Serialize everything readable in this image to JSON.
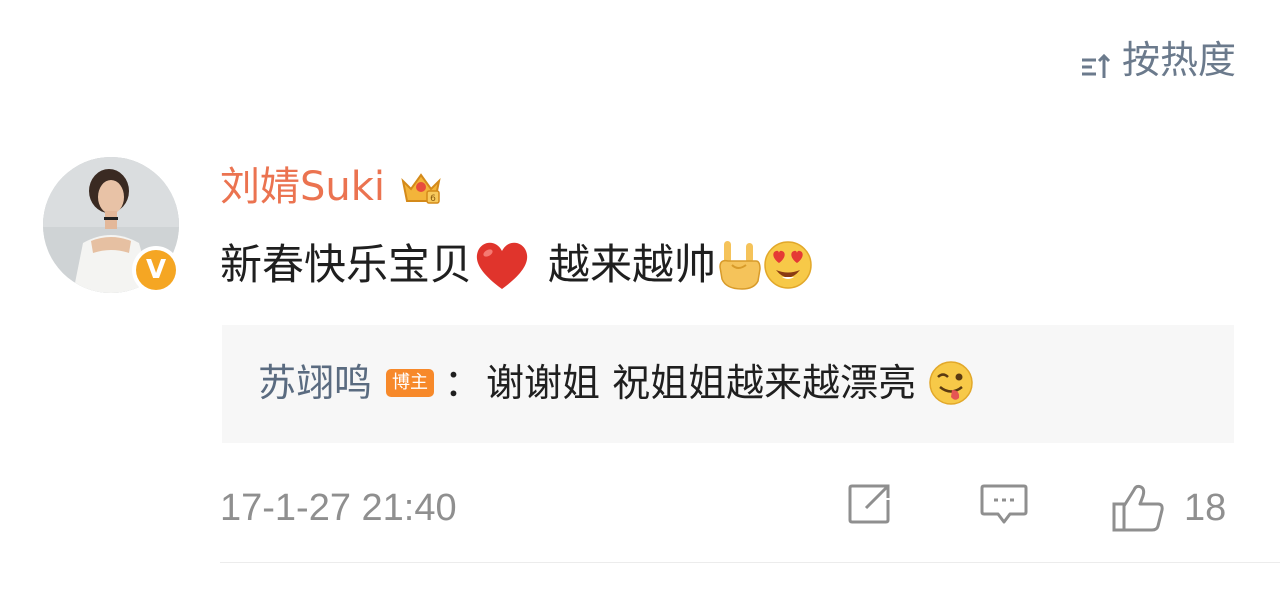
{
  "sort": {
    "label": "按热度",
    "icon": "sort-icon"
  },
  "comment": {
    "username": "刘婧Suki",
    "user_badge_icon": "crown-vip-icon",
    "verified_mark": "V",
    "text_part1": "新春快乐宝贝",
    "text_part2": "越来越帅",
    "emojis": [
      "red-heart",
      "rock-on-hand",
      "heart-eyes"
    ]
  },
  "reply": {
    "username": "苏翊鸣",
    "badge": "博主",
    "colon": "：",
    "text": "谢谢姐 祝姐姐越来越漂亮",
    "emoji": "winking-tongue"
  },
  "footer": {
    "timestamp": "17-1-27 21:40",
    "like_count": "18"
  },
  "colors": {
    "username": "#eb7350",
    "reply_user": "#5a6b80",
    "muted": "#8f8f8f",
    "badge": "#f7892a",
    "verified": "#f5a623"
  }
}
